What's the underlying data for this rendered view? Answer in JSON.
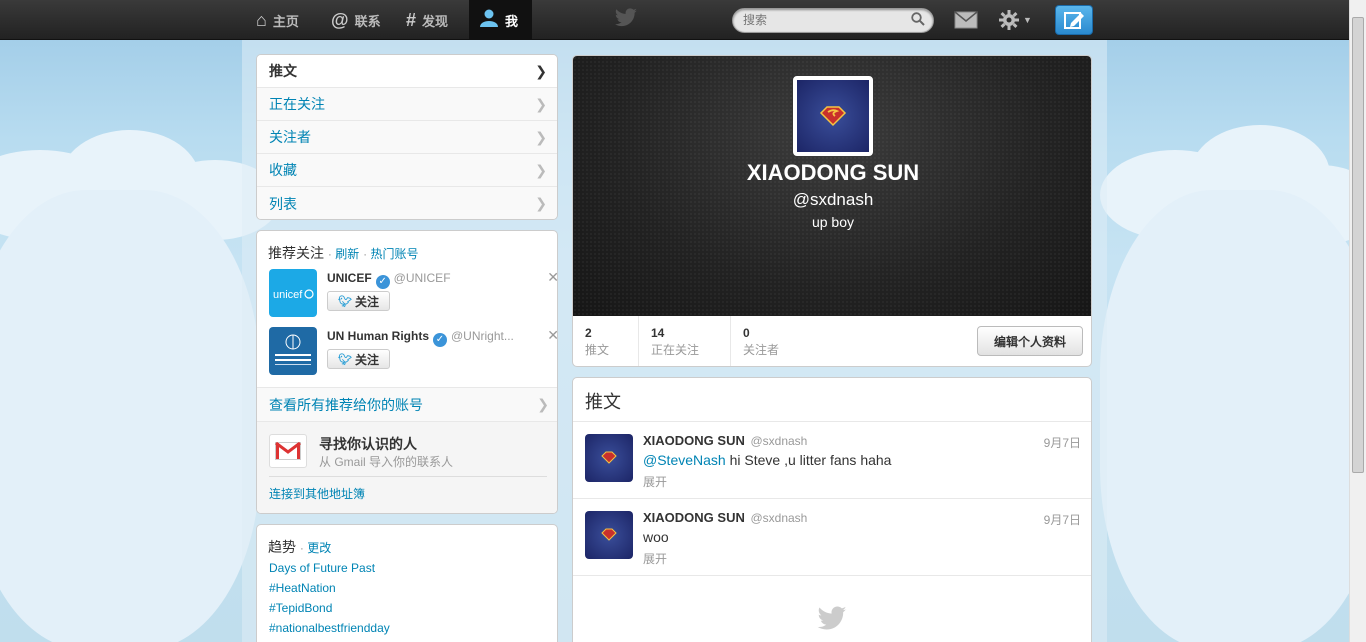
{
  "topbar": {
    "nav": [
      {
        "label": "主页",
        "icon": "home-icon"
      },
      {
        "label": "联系",
        "icon": "at-icon"
      },
      {
        "label": "发现",
        "icon": "hash-icon"
      },
      {
        "label": "我",
        "icon": "user-icon"
      }
    ],
    "search_placeholder": "搜索"
  },
  "profile_nav": [
    {
      "label": "推文"
    },
    {
      "label": "正在关注"
    },
    {
      "label": "关注者"
    },
    {
      "label": "收藏"
    },
    {
      "label": "列表"
    }
  ],
  "who_to_follow": {
    "title": "推荐关注",
    "refresh": "刷新",
    "popular": "热门账号",
    "users": [
      {
        "name": "UNICEF",
        "screen_name": "@UNICEF",
        "follow_label": "关注"
      },
      {
        "name": "UN Human Rights",
        "screen_name": "@UNright...",
        "follow_label": "关注"
      }
    ],
    "view_all": "查看所有推荐给你的账号",
    "find_friends_title": "寻找你认识的人",
    "find_friends_sub": "从 Gmail 导入你的联系人",
    "connect_other": "连接到其他地址簿"
  },
  "trends": {
    "title": "趋势",
    "change": "更改",
    "items": [
      "Days of Future Past",
      "#HeatNation",
      "#TepidBond",
      "#nationalbestfriendday"
    ]
  },
  "profile": {
    "name": "XIAODONG SUN",
    "handle": "@sxdnash",
    "bio": "up boy",
    "stats": [
      {
        "num": "2",
        "label": "推文"
      },
      {
        "num": "14",
        "label": "正在关注"
      },
      {
        "num": "0",
        "label": "关注者"
      }
    ],
    "edit_label": "编辑个人资料"
  },
  "timeline": {
    "title": "推文",
    "tweets": [
      {
        "name": "XIAODONG SUN",
        "screen_name": "@sxdnash",
        "time": "9月7日",
        "mention": "@SteveNash",
        "text": " hi Steve ,u litter fans haha",
        "expand": "展开"
      },
      {
        "name": "XIAODONG SUN",
        "screen_name": "@sxdnash",
        "time": "9月7日",
        "mention": "",
        "text": "woo",
        "expand": "展开"
      }
    ]
  },
  "colors": {
    "link": "#0084b4",
    "topbar": "#222222",
    "sky": "#c0deed"
  }
}
